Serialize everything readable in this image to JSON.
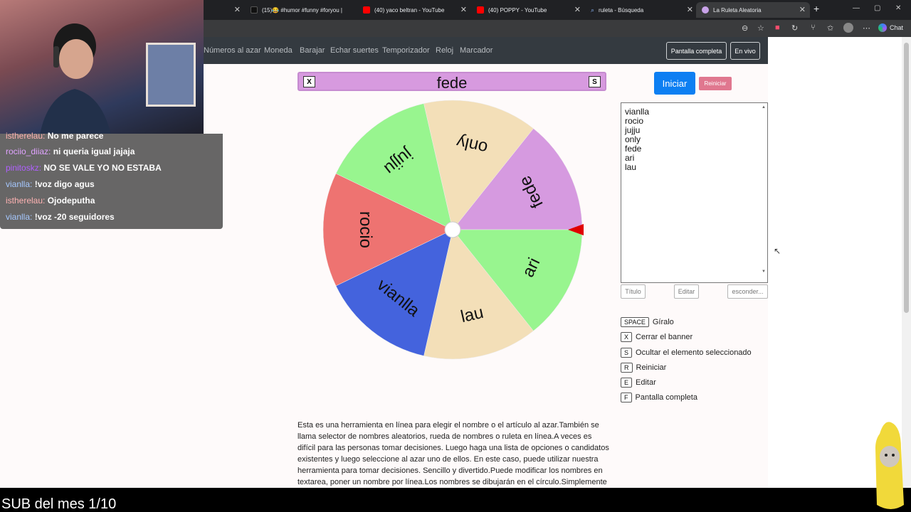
{
  "tabs": [
    {
      "label": "",
      "favicon_color": "#ff4d6d"
    },
    {
      "label": "(15)😂 #humor #funny #foryou | ",
      "favicon_color": "#111111"
    },
    {
      "label": "(40) yaco beltran - YouTube",
      "favicon_color": "#ff0000"
    },
    {
      "label": "(40) POPPY - YouTube",
      "favicon_color": "#ff0000"
    },
    {
      "label": "ruleta - Búsqueda",
      "favicon_color": "#1a73e8"
    },
    {
      "label": "La Ruleta Aleatoria",
      "favicon_color": "#c8a2e8"
    }
  ],
  "toolbar": {
    "chat_label": "Chat"
  },
  "nav": {
    "links": [
      "Números al azar",
      "Moneda",
      "Barajar",
      "Echar suertes",
      "Temporizador",
      "Reloj",
      "Marcador"
    ],
    "fullscreen_label": "Pantalla completa",
    "live_label": "En vivo"
  },
  "banner": {
    "selected": "fede",
    "close_key": "X",
    "hide_key": "S"
  },
  "wheel": {
    "pointer_color": "#e00000",
    "segments": [
      {
        "name": "fede",
        "color": "#d69ae0"
      },
      {
        "name": "ari",
        "color": "#98f58f"
      },
      {
        "name": "lau",
        "color": "#f3dfb8"
      },
      {
        "name": "vianlla",
        "color": "#4463dd"
      },
      {
        "name": "rocio",
        "color": "#ee7371"
      },
      {
        "name": "jujju",
        "color": "#98f58f"
      },
      {
        "name": "only",
        "color": "#f3dfb8"
      }
    ]
  },
  "controls": {
    "start_label": "Iniciar",
    "reset_label": "Reiniciar"
  },
  "names_list": [
    "vianlla",
    "rocio",
    "jujju",
    "only",
    "fede",
    "ari",
    "lau"
  ],
  "small_buttons": {
    "title": "Título",
    "edit": "Editar",
    "hide": "esconder..."
  },
  "shortcuts": [
    {
      "key": "SPACE",
      "label": "Gíralo"
    },
    {
      "key": "X",
      "label": "Cerrar el banner"
    },
    {
      "key": "S",
      "label": "Ocultar el elemento seleccionado"
    },
    {
      "key": "R",
      "label": "Reiniciar"
    },
    {
      "key": "E",
      "label": "Editar"
    },
    {
      "key": "F",
      "label": "Pantalla completa"
    }
  ],
  "description": "Esta es una herramienta en línea para elegir el nombre o el artículo al azar.También se llama selector de nombres aleatorios, rueda de nombres o ruleta en línea.A veces es difícil para las personas tomar decisiones. Luego haga una lista de opciones o candidatos existentes y luego seleccione al azar uno de ellos. En este caso, puede utilizar nuestra herramienta para tomar decisiones. Sencillo y divertido.Puede modificar los nombres en textarea, poner un nombre por línea.Los nombres se dibujarán en el círculo.Simplemente haga clic en la rueda",
  "stream_chat": [
    {
      "user": "istherelau:",
      "message": "No me parece",
      "color": "#ffb3b3"
    },
    {
      "user": "rociio_diiaz:",
      "message": "ni queria igual jajaja",
      "color": "#e0a3ff"
    },
    {
      "user": "pinitoskz:",
      "message": "NO SE VALE YO NO ESTABA",
      "color": "#b060ff"
    },
    {
      "user": "vianlla:",
      "message": "!voz digo agus",
      "color": "#a6c8ff"
    },
    {
      "user": "istherelau:",
      "message": "Ojodeputha",
      "color": "#ffb3b3"
    },
    {
      "user": "vianlla:",
      "message": "!voz -20 seguidores",
      "color": "#a6c8ff"
    }
  ],
  "sub_goal": "SUB del mes 1/10"
}
